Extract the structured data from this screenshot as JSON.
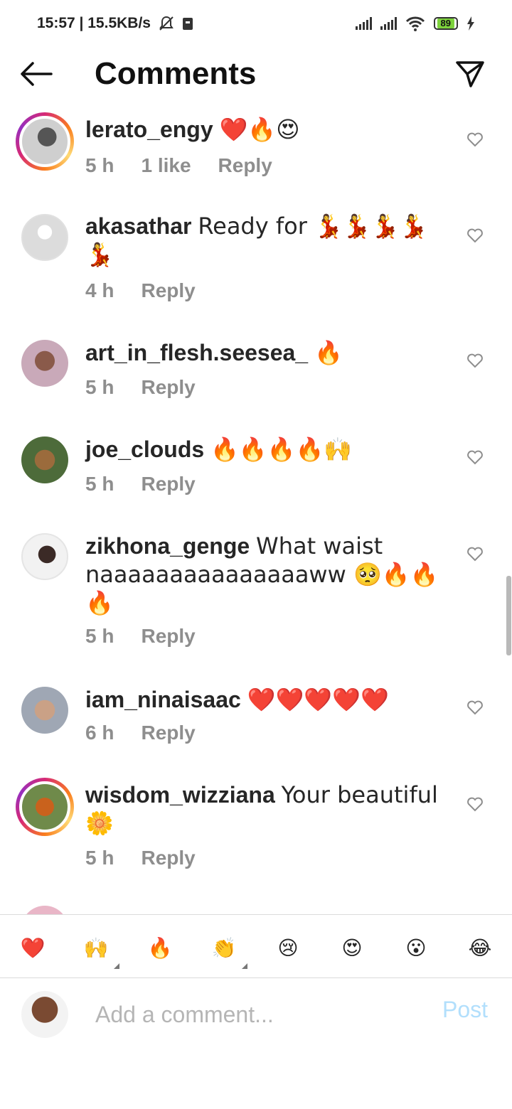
{
  "status": {
    "time_speed": "15:57 | 15.5KB/s",
    "battery": "89"
  },
  "header": {
    "title": "Comments"
  },
  "comments": [
    {
      "user": "lerato_engy",
      "text": "❤️🔥😍",
      "time": "5 h",
      "likes": "1 like",
      "reply": "Reply"
    },
    {
      "user": "akasathar",
      "text": "Ready for 💃💃💃💃💃",
      "time": "4 h",
      "reply": "Reply"
    },
    {
      "user": "art_in_flesh.seesea_",
      "text": "🔥",
      "time": "5 h",
      "reply": "Reply"
    },
    {
      "user": "joe_clouds",
      "text": "🔥🔥🔥🔥🙌",
      "time": "5 h",
      "reply": "Reply"
    },
    {
      "user": "zikhona_genge",
      "text": "What waist naaaaaaaaaaaaaaaww 🥺🔥🔥🔥",
      "time": "5 h",
      "reply": "Reply"
    },
    {
      "user": "iam_ninaisaac",
      "text": "❤️❤️❤️❤️❤️",
      "time": "6 h",
      "reply": "Reply"
    },
    {
      "user": "wisdom_wizziana",
      "text": "Your beautiful 🌼",
      "time": "5 h",
      "reply": "Reply"
    }
  ],
  "emoji_bar": [
    "❤️",
    "🙌",
    "🔥",
    "👏",
    "😢",
    "😍",
    "😮",
    "😂"
  ],
  "composer": {
    "placeholder": "Add a comment...",
    "post_label": "Post"
  }
}
